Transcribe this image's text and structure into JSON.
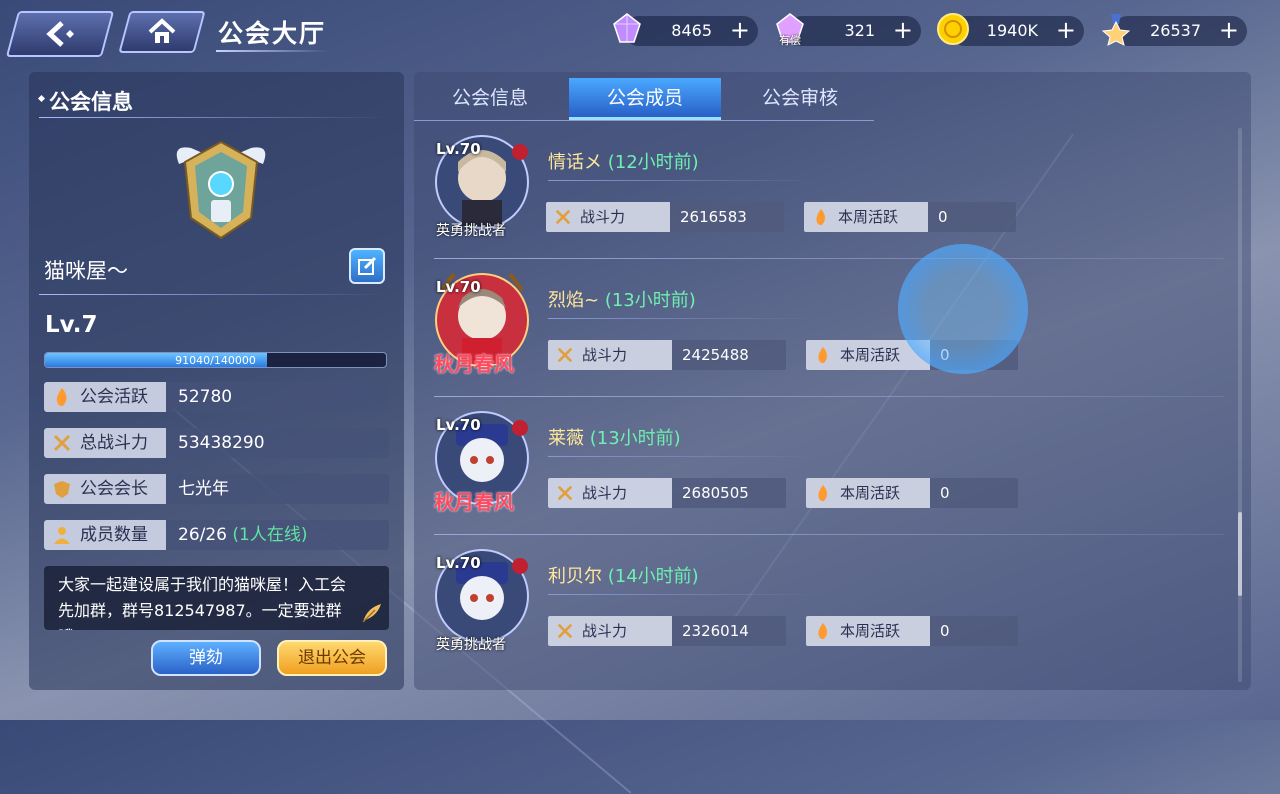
{
  "header": {
    "title": "公会大厅"
  },
  "resources": [
    {
      "name": "crystal",
      "value": "8465",
      "color": "#c08cff"
    },
    {
      "name": "bound-crystal",
      "value": "321",
      "sub": "有偿",
      "color": "#e0a0ff"
    },
    {
      "name": "gold",
      "value": "1940K",
      "color": "#ffd000"
    },
    {
      "name": "medal",
      "value": "26537",
      "color": "#ffd27a"
    }
  ],
  "left": {
    "title": "公会信息",
    "guild_name": "猫咪屋～",
    "level": "Lv.7",
    "exp_text": "91040/140000",
    "exp_progress": 0.65,
    "stats": [
      {
        "label": "公会活跃",
        "value": "52780"
      },
      {
        "label": "总战斗力",
        "value": "53438290"
      },
      {
        "label": "公会会长",
        "value": "七光年"
      },
      {
        "label": "成员数量",
        "value": "26/26",
        "extra": "(1人在线)"
      }
    ],
    "notice": "大家一起建设属于我们的猫咪屋！入工会先加群，群号812547987。一定要进群哦",
    "kick_label": "弹劾",
    "quit_label": "退出公会"
  },
  "tabs": [
    {
      "label": "公会信息"
    },
    {
      "label": "公会成员",
      "active": true
    },
    {
      "label": "公会审核"
    }
  ],
  "members": [
    {
      "level": "Lv.70",
      "name": "情话メ",
      "time": "(12小时前)",
      "title": "英勇挑战者",
      "power_label": "战斗力",
      "power": "2616583",
      "active_label": "本周活跃",
      "active": "0"
    },
    {
      "level": "Lv.70",
      "name": "烈焰~",
      "time": "(13小时前)",
      "title": "秋月春风",
      "power_label": "战斗力",
      "power": "2425488",
      "active_label": "本周活跃",
      "active": "0"
    },
    {
      "level": "Lv.70",
      "name": "莱薇",
      "time": "(13小时前)",
      "title": "秋月春风",
      "power_label": "战斗力",
      "power": "2680505",
      "active_label": "本周活跃",
      "active": "0"
    },
    {
      "level": "Lv.70",
      "name": "利贝尔",
      "time": "(14小时前)",
      "title": "英勇挑战者",
      "power_label": "战斗力",
      "power": "2326014",
      "active_label": "本周活跃",
      "active": "0"
    }
  ]
}
